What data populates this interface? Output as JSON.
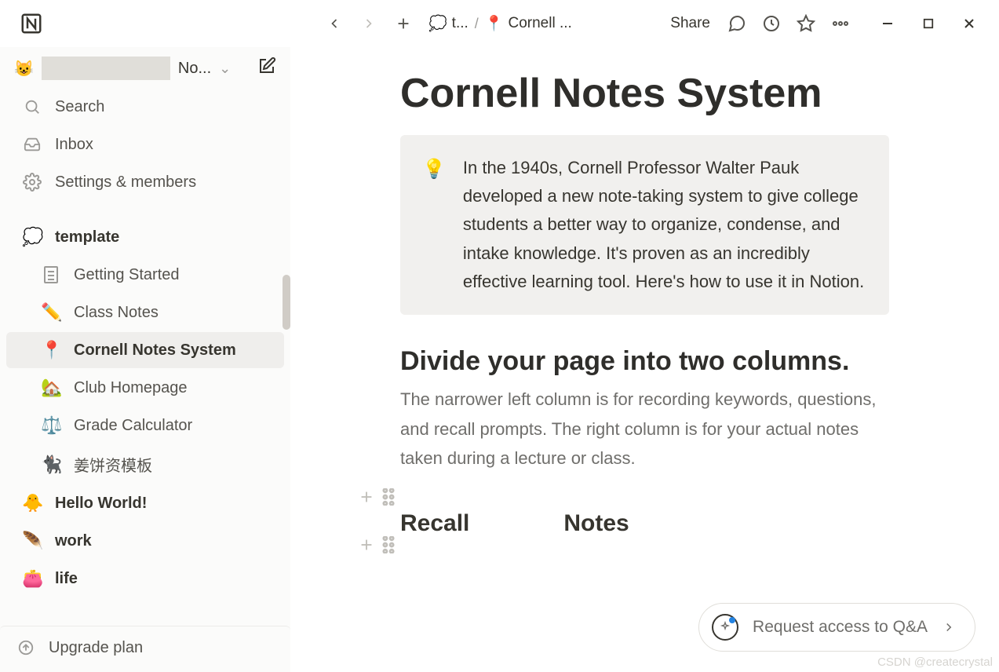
{
  "titlebar": {
    "breadcrumb": {
      "seg1_icon": "💭",
      "seg1_label": "t...",
      "seg2_icon": "📍",
      "seg2_label": "Cornell ..."
    },
    "share_label": "Share"
  },
  "sidebar": {
    "workspace_emoji": "😺",
    "workspace_name": "No...",
    "search_label": "Search",
    "inbox_label": "Inbox",
    "settings_label": "Settings & members",
    "upgrade_label": "Upgrade plan",
    "pages": {
      "template": {
        "icon": "💭",
        "label": "template"
      },
      "getting_started": {
        "label": "Getting Started"
      },
      "class_notes": {
        "icon": "✏️",
        "label": "Class Notes"
      },
      "cornell": {
        "icon": "📍",
        "label": "Cornell Notes System"
      },
      "club": {
        "icon": "🏡",
        "label": "Club Homepage"
      },
      "grade": {
        "icon": "⚖️",
        "label": "Grade Calculator"
      },
      "ginger": {
        "icon": "🐈‍⬛",
        "label": "姜饼资模板"
      },
      "hello": {
        "icon": "🐥",
        "label": "Hello World!"
      },
      "work": {
        "icon": "🪶",
        "label": "work"
      },
      "life": {
        "icon": "👛",
        "label": "life"
      }
    }
  },
  "page": {
    "title": "Cornell Notes System",
    "callout_icon": "💡",
    "callout_text": "In the 1940s, Cornell Professor Walter Pauk developed a new note-taking system to give college students a better way to organize, condense, and intake knowledge. It's proven as an incredibly effective learning tool. Here's how to use it in Notion.",
    "heading2": "Divide your page into two columns.",
    "paragraph": "The narrower left column is for recording keywords, questions, and recall prompts. The right column is for your actual notes taken during a lecture or class.",
    "col_recall": "Recall",
    "col_notes": "Notes"
  },
  "qa_pill": "Request access to Q&A",
  "watermark": "CSDN @createcrystal"
}
